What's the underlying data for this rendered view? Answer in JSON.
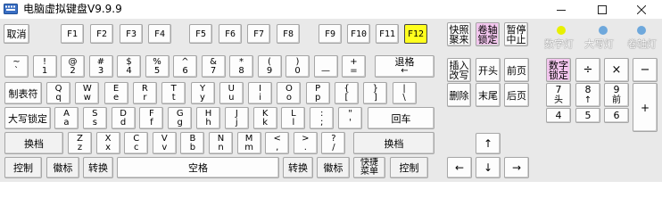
{
  "window": {
    "title": "电脑虚拟键盘V9.9.9",
    "icons": {
      "app": "keyboard-icon",
      "minimize": "minimize-icon",
      "maximize": "maximize-icon",
      "close": "close-icon"
    }
  },
  "row_fn": {
    "cancel": "取消",
    "f1": "F1",
    "f2": "F2",
    "f3": "F3",
    "f4": "F4",
    "f5": "F5",
    "f6": "F6",
    "f7": "F7",
    "f8": "F8",
    "f9": "F9",
    "f10": "F10",
    "f11": "F11",
    "f12": "F12",
    "quick_photo": "快照\n聚来",
    "roll_lock": "卷轴\n锁定",
    "pause": "暂停\n中止"
  },
  "indicators": [
    {
      "label": "数字灯",
      "color": "#e8f000"
    },
    {
      "label": "大写灯",
      "color": "#6ea8dc"
    },
    {
      "label": "卷轴灯",
      "color": "#6ea8dc"
    }
  ],
  "row_num": [
    {
      "top": "~",
      "bot": "`"
    },
    {
      "top": "!",
      "bot": "1"
    },
    {
      "top": "@",
      "bot": "2"
    },
    {
      "top": "#",
      "bot": "3"
    },
    {
      "top": "$",
      "bot": "4"
    },
    {
      "top": "%",
      "bot": "5"
    },
    {
      "top": "^",
      "bot": "6"
    },
    {
      "top": "&",
      "bot": "7"
    },
    {
      "top": "*",
      "bot": "8"
    },
    {
      "top": "(",
      "bot": "9"
    },
    {
      "top": ")",
      "bot": "0"
    },
    {
      "top": "",
      "bot": "—"
    },
    {
      "top": "+",
      "bot": "="
    }
  ],
  "backspace": {
    "top": "退格",
    "bot": "←"
  },
  "row_q": {
    "tab": "制表符",
    "keys": [
      {
        "top": "Q",
        "bot": "q"
      },
      {
        "top": "W",
        "bot": "w"
      },
      {
        "top": "E",
        "bot": "e"
      },
      {
        "top": "R",
        "bot": "r"
      },
      {
        "top": "T",
        "bot": "t"
      },
      {
        "top": "Y",
        "bot": "y"
      },
      {
        "top": "U",
        "bot": "u"
      },
      {
        "top": "I",
        "bot": "i"
      },
      {
        "top": "O",
        "bot": "o"
      },
      {
        "top": "P",
        "bot": "p"
      },
      {
        "top": "{",
        "bot": "["
      },
      {
        "top": "}",
        "bot": "]"
      },
      {
        "top": "|",
        "bot": "\\"
      }
    ]
  },
  "row_a": {
    "caps": "大写锁定",
    "keys": [
      {
        "top": "A",
        "bot": "a"
      },
      {
        "top": "S",
        "bot": "s"
      },
      {
        "top": "D",
        "bot": "d"
      },
      {
        "top": "F",
        "bot": "f"
      },
      {
        "top": "G",
        "bot": "g"
      },
      {
        "top": "H",
        "bot": "h"
      },
      {
        "top": "J",
        "bot": "j"
      },
      {
        "top": "K",
        "bot": "k"
      },
      {
        "top": "L",
        "bot": "l"
      },
      {
        "top": ":",
        "bot": ";"
      },
      {
        "top": "\"",
        "bot": "'"
      }
    ],
    "enter": "回车"
  },
  "row_z": {
    "shift_left": "换档",
    "keys": [
      {
        "top": "Z",
        "bot": "z"
      },
      {
        "top": "X",
        "bot": "x"
      },
      {
        "top": "C",
        "bot": "c"
      },
      {
        "top": "V",
        "bot": "v"
      },
      {
        "top": "B",
        "bot": "b"
      },
      {
        "top": "N",
        "bot": "n"
      },
      {
        "top": "M",
        "bot": "m"
      },
      {
        "top": "<",
        "bot": ","
      },
      {
        "top": ">",
        "bot": "."
      },
      {
        "top": "?",
        "bot": "/"
      }
    ],
    "shift_right": "换档"
  },
  "row_space": {
    "ctrl_left": "控制",
    "win_left": "徽标",
    "alt_left": "转换",
    "space": "空格",
    "alt_right": "转换",
    "win_right": "徽标",
    "menu": "快捷\n菜单",
    "ctrl_right": "控制"
  },
  "nav": {
    "insert": "插入\n改写",
    "home": "开头",
    "page_up": "前页",
    "delete": "删除",
    "end": "末尾",
    "page_down": "后页",
    "up": "↑",
    "left": "←",
    "down": "↓",
    "right": "→"
  },
  "numpad": {
    "numlock": "数字\n锁定",
    "divide": "÷",
    "multiply": "×",
    "minus": "−",
    "n7": {
      "top": "7",
      "bot": "头"
    },
    "n8": {
      "top": "8",
      "bot": "↑"
    },
    "n9": {
      "top": "9",
      "bot": "前"
    },
    "n4": "4",
    "n5": "5",
    "n6": "6",
    "plus": "+"
  }
}
